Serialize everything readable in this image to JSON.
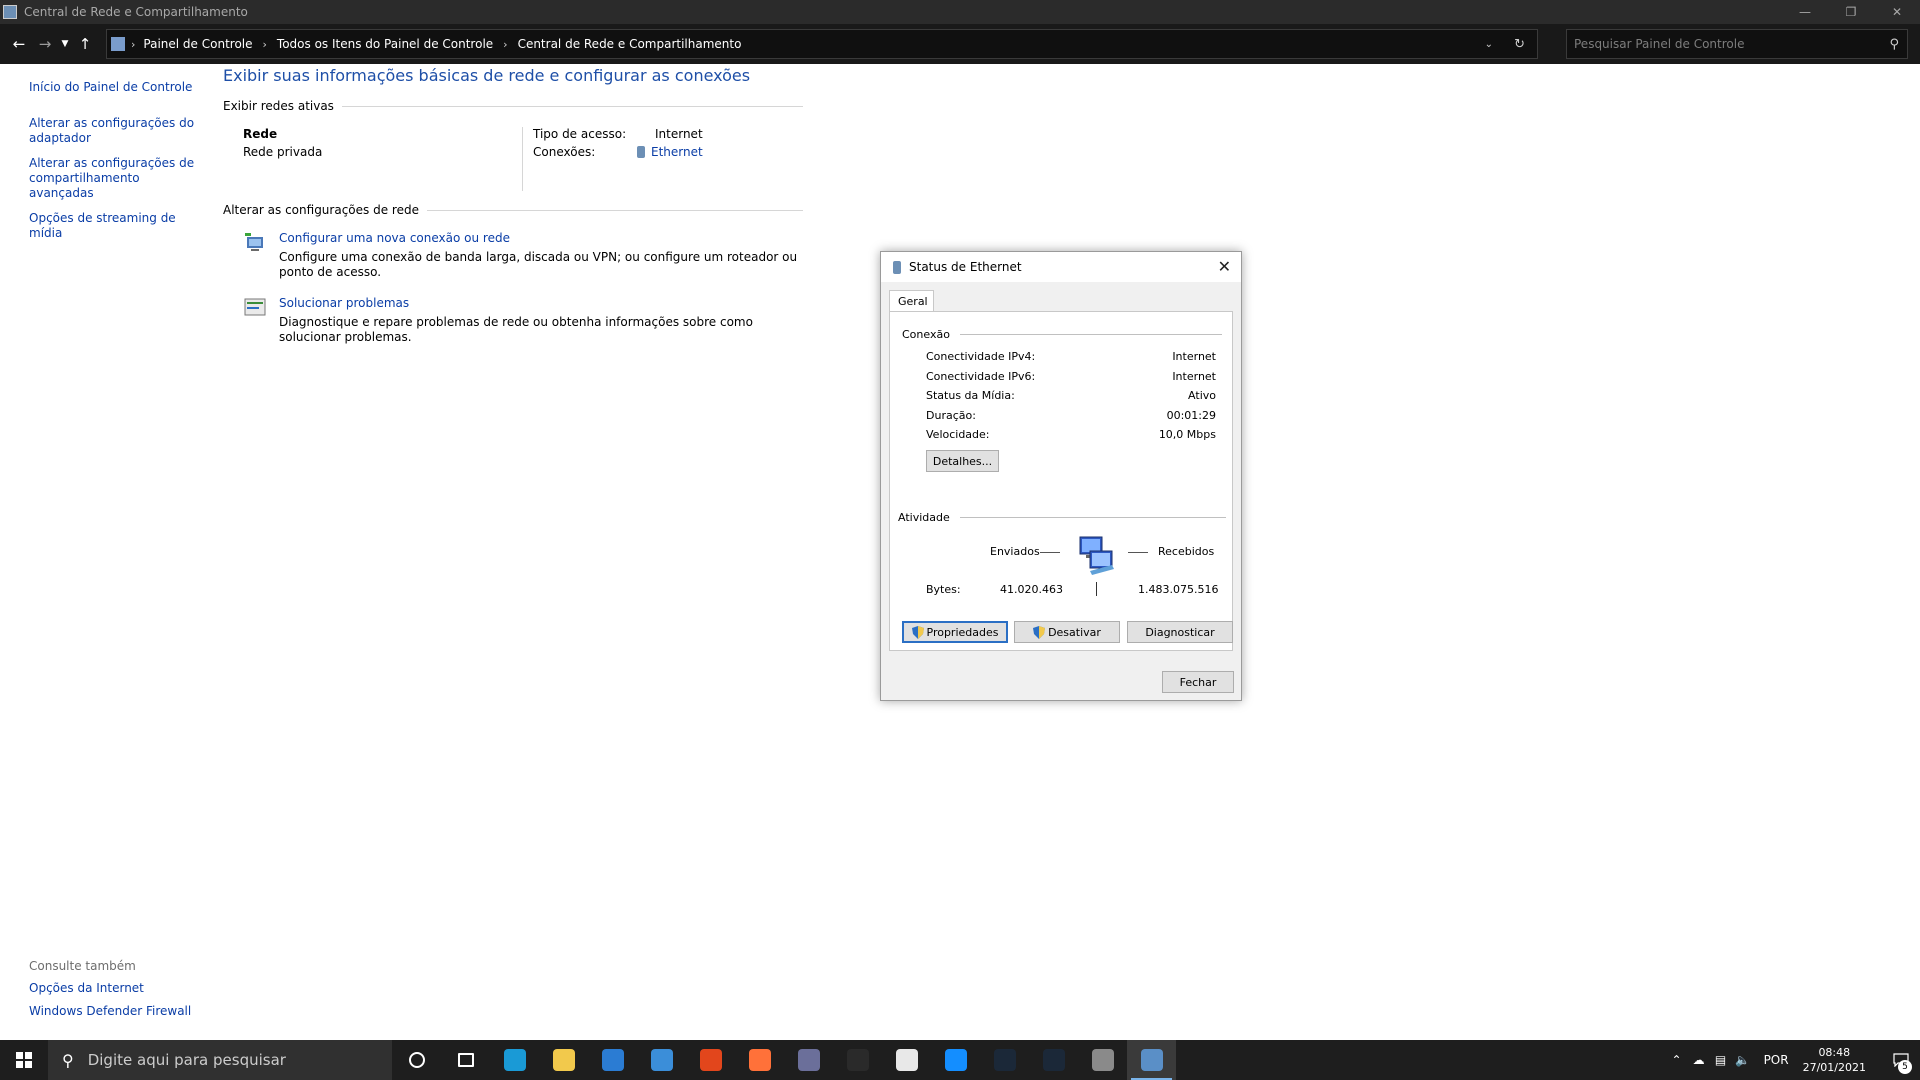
{
  "window": {
    "title": "Central de Rede e Compartilhamento",
    "icon": "control-panel-icon",
    "controls": [
      "minimize-icon",
      "restore-icon",
      "close-icon"
    ]
  },
  "addressbar": {
    "breadcrumbs": [
      "Painel de Controle",
      "Todos os Itens do Painel de Controle",
      "Central de Rede e Compartilhamento"
    ],
    "search_placeholder": "Pesquisar Painel de Controle"
  },
  "leftnav": {
    "home": "Início do Painel de Controle",
    "items": [
      "Alterar as configurações do adaptador",
      "Alterar as configurações de compartilhamento avançadas",
      "Opções de streaming de mídia"
    ],
    "see_also_label": "Consulte também",
    "see_also": [
      "Opções da Internet",
      "Windows Defender Firewall"
    ]
  },
  "main": {
    "title": "Exibir suas informações básicas de rede e configurar as conexões",
    "active_networks_header": "Exibir redes ativas",
    "network": {
      "name": "Rede",
      "type": "Rede privada",
      "access_label": "Tipo de acesso:",
      "access_value": "Internet",
      "connections_label": "Conexões:",
      "connections_value": "Ethernet"
    },
    "change_settings_header": "Alterar as configurações de rede",
    "tasks": [
      {
        "link": "Configurar uma nova conexão ou rede",
        "desc": "Configure uma conexão de banda larga, discada ou VPN; ou configure um roteador ou ponto de acesso."
      },
      {
        "link": "Solucionar problemas",
        "desc": "Diagnostique e repare problemas de rede ou obtenha informações sobre como solucionar problemas."
      }
    ]
  },
  "dialog": {
    "title": "Status de Ethernet",
    "tab": "Geral",
    "connection_group": "Conexão",
    "rows": [
      {
        "k": "Conectividade IPv4:",
        "v": "Internet"
      },
      {
        "k": "Conectividade IPv6:",
        "v": "Internet"
      },
      {
        "k": "Status da Mídia:",
        "v": "Ativo"
      },
      {
        "k": "Duração:",
        "v": "00:01:29"
      },
      {
        "k": "Velocidade:",
        "v": "10,0 Mbps"
      }
    ],
    "details_button": "Detalhes...",
    "activity_group": "Atividade",
    "sent_label": "Enviados",
    "received_label": "Recebidos",
    "bytes_label": "Bytes:",
    "bytes_sent": "41.020.463",
    "bytes_received": "1.483.075.516",
    "properties_button": "Propriedades",
    "disable_button": "Desativar",
    "diagnose_button": "Diagnosticar",
    "close_button": "Fechar"
  },
  "taskbar": {
    "search_placeholder": "Digite aqui para pesquisar",
    "apps": [
      {
        "name": "cortana-icon",
        "color": "#1e1e1e"
      },
      {
        "name": "task-view-icon",
        "color": "#1e1e1e"
      },
      {
        "name": "edge-icon",
        "color": "#1a9ad6"
      },
      {
        "name": "file-explorer-icon",
        "color": "#f2c94c"
      },
      {
        "name": "store-icon",
        "color": "#2b7cd3"
      },
      {
        "name": "mail-icon",
        "color": "#3b8ed9"
      },
      {
        "name": "office-icon",
        "color": "#e2461c"
      },
      {
        "name": "firefox-icon",
        "color": "#ff7139"
      },
      {
        "name": "chat-icon",
        "color": "#6b6f9a"
      },
      {
        "name": "epic-games-icon",
        "color": "#2a2a2a"
      },
      {
        "name": "ubisoft-icon",
        "color": "#e8e8e8"
      },
      {
        "name": "battle-net-icon",
        "color": "#148eff"
      },
      {
        "name": "steam-icon",
        "color": "#1b2838"
      },
      {
        "name": "steam-icon-2",
        "color": "#1b2838"
      },
      {
        "name": "app-icon",
        "color": "#8a8a8a"
      },
      {
        "name": "control-panel-taskbar-icon",
        "color": "#5a8fc7"
      }
    ],
    "language": "POR",
    "time": "08:48",
    "date": "27/01/2021",
    "notifications": "5"
  }
}
